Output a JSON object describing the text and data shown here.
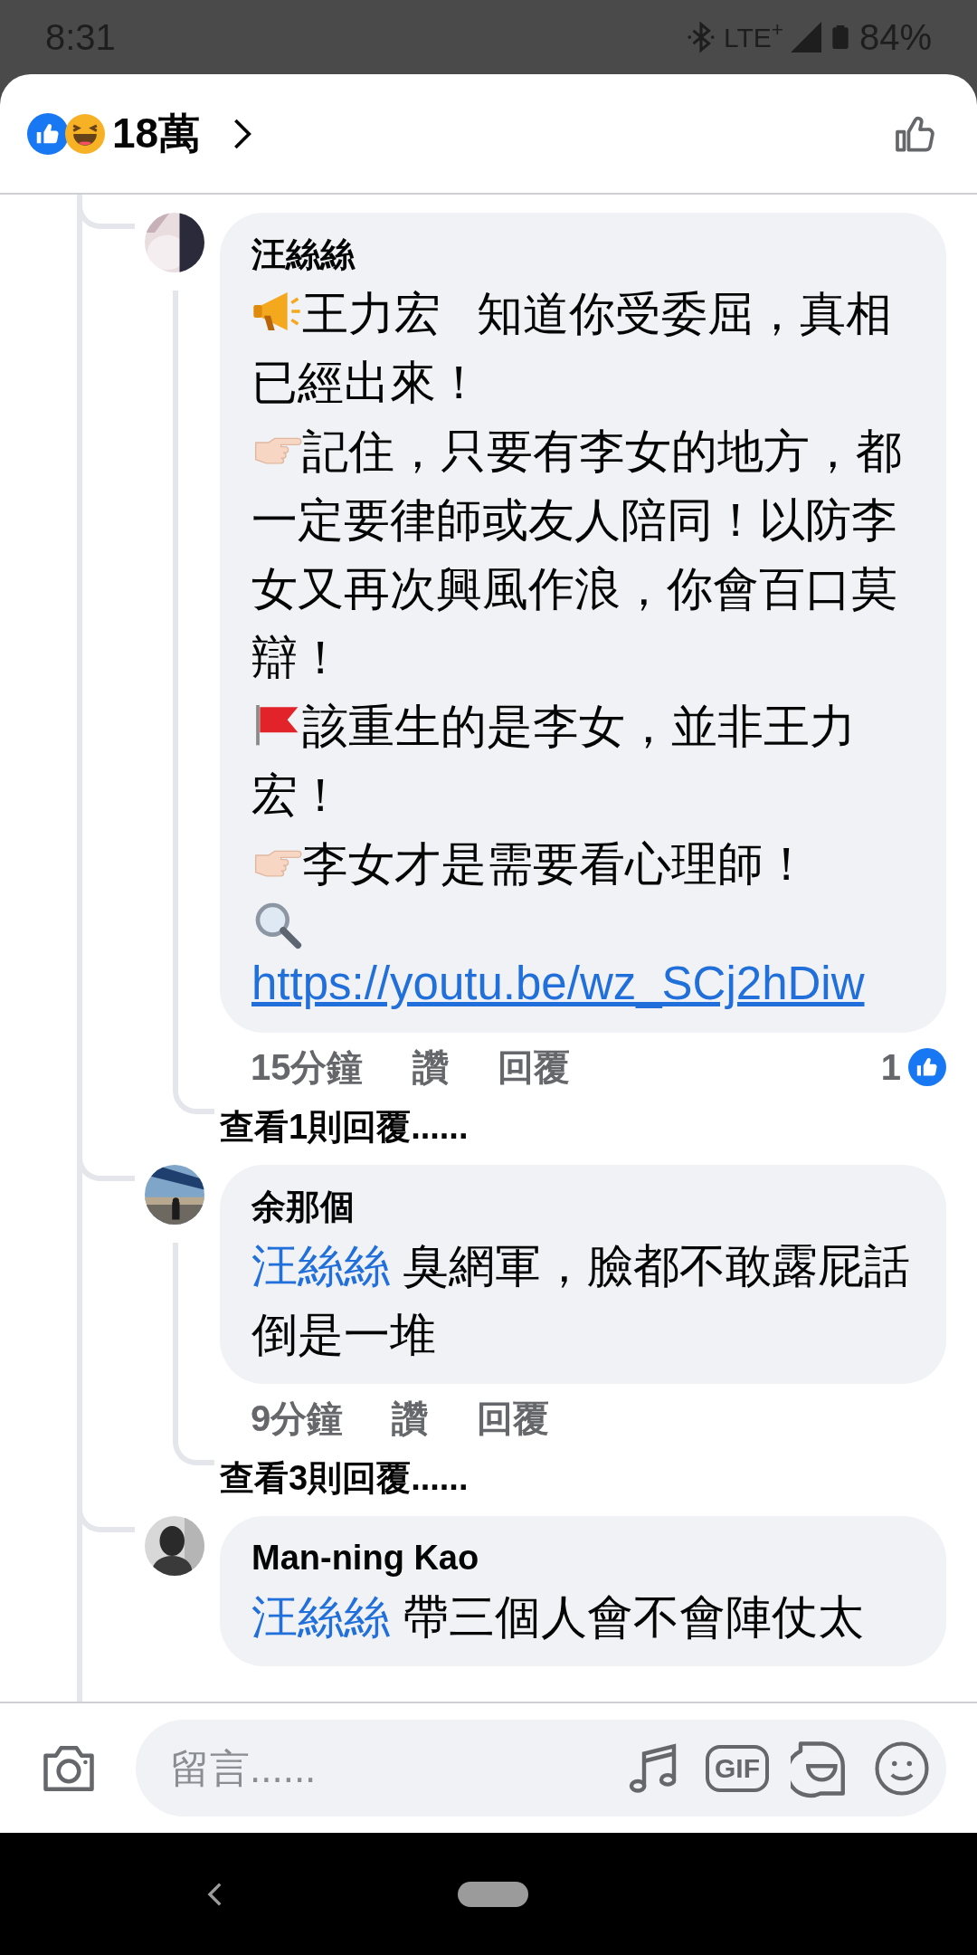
{
  "status_bar": {
    "time": "8:31",
    "network": "LTE$^{+}$",
    "battery": "84%"
  },
  "header": {
    "reaction_count": "18萬"
  },
  "comments": [
    {
      "author": "汪絲絲",
      "paragraphs": [
        {
          "kind": "megaphone",
          "text": "王力宏 知道你受委屈，真相已經出來！"
        },
        {
          "kind": "pointer",
          "text": "記住，只要有李女的地方，都一定要律師或友人陪同！以防李女又再次興風作浪，你會百口莫辯！"
        },
        {
          "kind": "flag",
          "text": "該重生的是李女，並非王力宏！"
        },
        {
          "kind": "pointer",
          "text": "李女才是需要看心理師！"
        },
        {
          "kind": "search",
          "link": "https://youtu.be/wz_SCj2hDiw"
        }
      ],
      "time": "15分鐘",
      "like": "讚",
      "reply": "回覆",
      "reactions": "1",
      "view_replies": "查看1則回覆......"
    },
    {
      "author": "余那個",
      "mention": "汪絲絲",
      "text": "臭網軍，臉都不敢露屁話倒是一堆",
      "time": "9分鐘",
      "like": "讚",
      "reply": "回覆",
      "view_replies": "查看3則回覆......"
    },
    {
      "author": "Man-ning Kao",
      "mention": "汪絲絲",
      "text": "帶三個人會不會陣仗太"
    }
  ],
  "composer": {
    "placeholder": "留言......",
    "gif_label": "GIF"
  }
}
